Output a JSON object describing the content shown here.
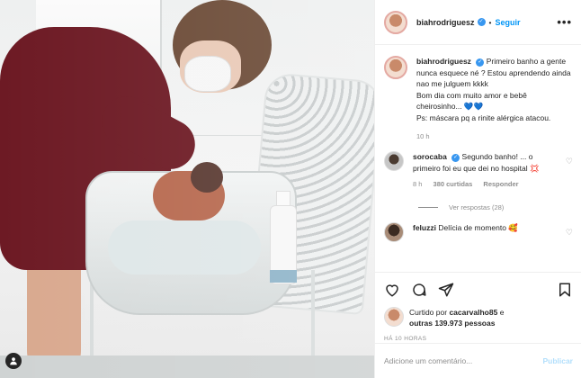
{
  "post": {
    "username": "biahrodriguesz",
    "separator": "•",
    "follow_label": "Seguir",
    "more_label": "•••",
    "caption": {
      "username": "biahrodriguesz",
      "text": "Primeiro banho a gente nunca esquece né ? Estou aprendendo ainda nao me julguem kkkk\nBom dia com muito amor e bebê cheirosinho... 💙💙\nPs: máscara pq a rinite alérgica atacou.",
      "time": "10 h"
    },
    "comments": [
      {
        "username": "sorocaba",
        "verified": true,
        "text": "Segundo banho! ... o primeiro foi eu que dei no hospital 💢",
        "time": "8 h",
        "likes": "380 curtidas",
        "reply_label": "Responder",
        "view_replies": "Ver respostas (28)"
      },
      {
        "username": "feluzzi",
        "text": "Delícia de momento 🥰"
      }
    ],
    "likes": {
      "prefix": "Curtido por",
      "first_user": "cacarvalho85",
      "connector": "e",
      "others": "outras 139.973 pessoas"
    },
    "posted_ago": "HÁ 10 HORAS",
    "add_comment_placeholder": "Adicione um comentário...",
    "publish_label": "Publicar"
  },
  "icons": [
    "heart-icon",
    "comment-icon",
    "share-icon",
    "bookmark-icon",
    "person-tag-icon",
    "verified-icon"
  ],
  "colors": {
    "accent": "#0095f6",
    "verified": "#3897f0",
    "muted": "#8e8e8e",
    "publish_disabled": "#b2dffc"
  }
}
